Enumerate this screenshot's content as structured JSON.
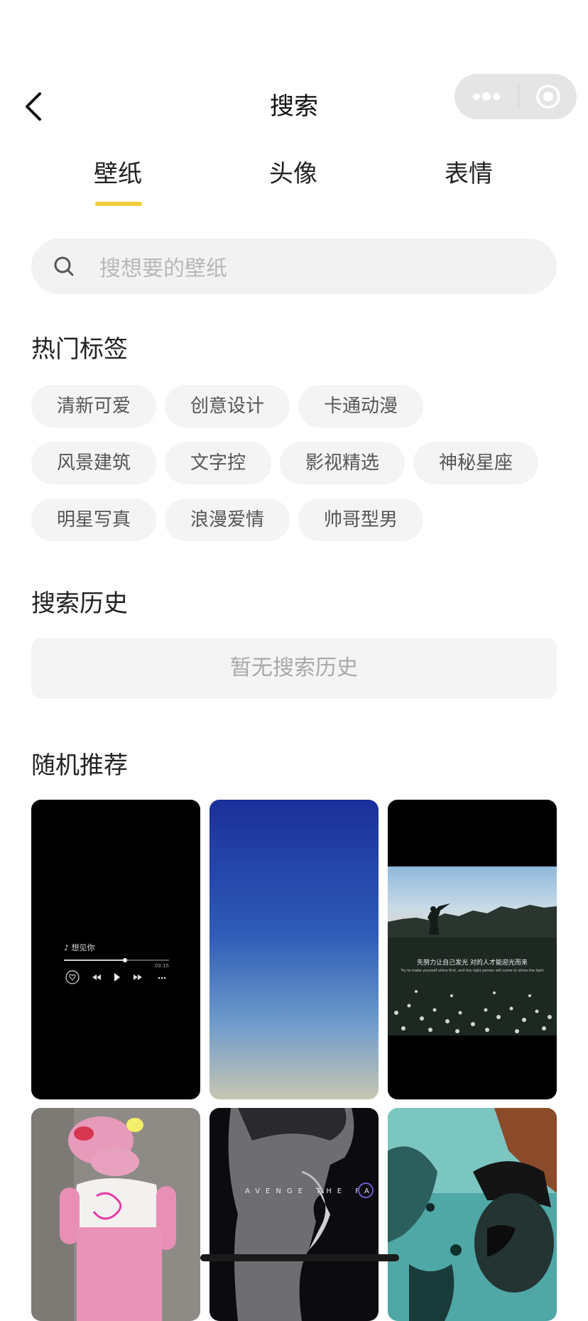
{
  "header": {
    "title": "搜索"
  },
  "tabs": [
    {
      "label": "壁纸",
      "active": true
    },
    {
      "label": "头像",
      "active": false
    },
    {
      "label": "表情",
      "active": false
    }
  ],
  "search": {
    "placeholder": "搜想要的壁纸"
  },
  "hot_tags": {
    "title": "热门标签",
    "rows": [
      [
        "清新可爱",
        "创意设计",
        "卡通动漫"
      ],
      [
        "风景建筑",
        "文字控",
        "影视精选",
        "神秘星座"
      ],
      [
        "明星写真",
        "浪漫爱情",
        "帅哥型男"
      ]
    ]
  },
  "history": {
    "title": "搜索历史",
    "empty_text": "暂无搜索历史"
  },
  "recommend": {
    "title": "随机推荐",
    "cards": [
      {
        "kind": "music-player",
        "song": "♪ 想见你",
        "time": "03:15"
      },
      {
        "kind": "gradient-sky"
      },
      {
        "kind": "dandelion-photo",
        "caption": "先努力让自己发光 对的人才能迎光而来",
        "caption_en": "Try to make yourself shine first, and the right person will come to shine the light"
      },
      {
        "kind": "pink-panther-toy"
      },
      {
        "kind": "avengers-portrait",
        "caption": "AVENGE THE FA"
      },
      {
        "kind": "teal-grunge-portrait"
      }
    ]
  },
  "colors": {
    "accent": "#f2cd3a",
    "tag_bg": "#f4f4f4",
    "search_bg": "#f2f2f2"
  }
}
